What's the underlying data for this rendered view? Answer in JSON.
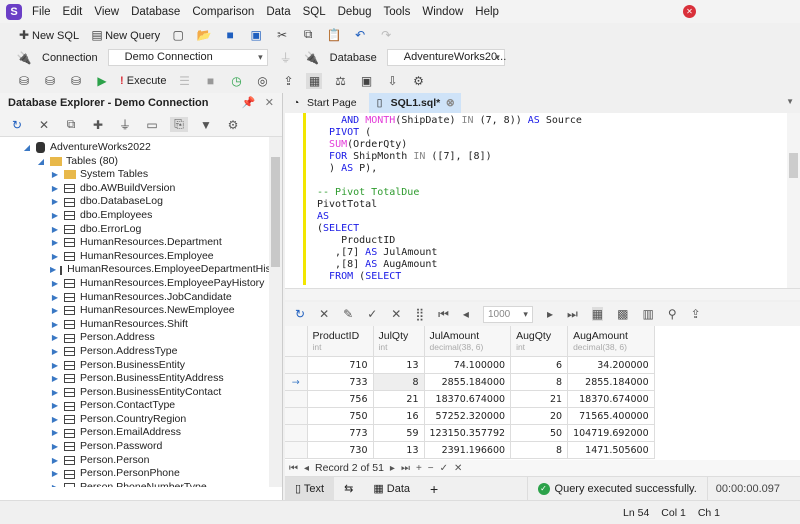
{
  "menu": [
    "File",
    "Edit",
    "View",
    "Database",
    "Comparison",
    "Data",
    "SQL",
    "Debug",
    "Tools",
    "Window",
    "Help"
  ],
  "toolbar1": {
    "new_sql": "New SQL",
    "new_query": "New Query"
  },
  "toolbar2": {
    "connection_label": "Connection",
    "connection_value": "Demo Connection",
    "database_label": "Database",
    "database_value": "AdventureWorks20..."
  },
  "toolbar3": {
    "execute": "Execute"
  },
  "explorer": {
    "title": "Database Explorer - Demo Connection",
    "root": "AdventureWorks2022",
    "tables_folder": "Tables (80)",
    "system_tables": "System Tables",
    "tables": [
      "dbo.AWBuildVersion",
      "dbo.DatabaseLog",
      "dbo.Employees",
      "dbo.ErrorLog",
      "HumanResources.Department",
      "HumanResources.Employee",
      "HumanResources.EmployeeDepartmentHistory",
      "HumanResources.EmployeePayHistory",
      "HumanResources.JobCandidate",
      "HumanResources.NewEmployee",
      "HumanResources.Shift",
      "Person.Address",
      "Person.AddressType",
      "Person.BusinessEntity",
      "Person.BusinessEntityAddress",
      "Person.BusinessEntityContact",
      "Person.ContactType",
      "Person.CountryRegion",
      "Person.EmailAddress",
      "Person.Password",
      "Person.Person",
      "Person.PersonPhone",
      "Person.PhoneNumberType"
    ]
  },
  "tabs": [
    {
      "label": "Start Page"
    },
    {
      "label": "SQL1.sql*"
    }
  ],
  "grid": {
    "page_size": "1000",
    "columns": [
      {
        "name": "ProductID",
        "type": "int"
      },
      {
        "name": "JulQty",
        "type": "int"
      },
      {
        "name": "JulAmount",
        "type": "decimal(38, 6)"
      },
      {
        "name": "AugQty",
        "type": "int"
      },
      {
        "name": "AugAmount",
        "type": "decimal(38, 6)"
      }
    ],
    "rows": [
      [
        "710",
        "13",
        "74.100000",
        "6",
        "34.200000"
      ],
      [
        "733",
        "8",
        "2855.184000",
        "8",
        "2855.184000"
      ],
      [
        "756",
        "21",
        "18370.674000",
        "21",
        "18370.674000"
      ],
      [
        "750",
        "16",
        "57252.320000",
        "20",
        "71565.400000"
      ],
      [
        "773",
        "59",
        "123150.357792",
        "50",
        "104719.692000"
      ],
      [
        "730",
        "13",
        "2391.196600",
        "8",
        "1471.505600"
      ]
    ],
    "record": "Record 2 of 51"
  },
  "bottom_tabs": {
    "text": "Text",
    "data": "Data",
    "add": "+"
  },
  "result": {
    "message": "Query executed successfully.",
    "time": "00:00:00.097"
  },
  "status": {
    "ln": "Ln 54",
    "col": "Col 1",
    "ch": "Ch 1"
  }
}
